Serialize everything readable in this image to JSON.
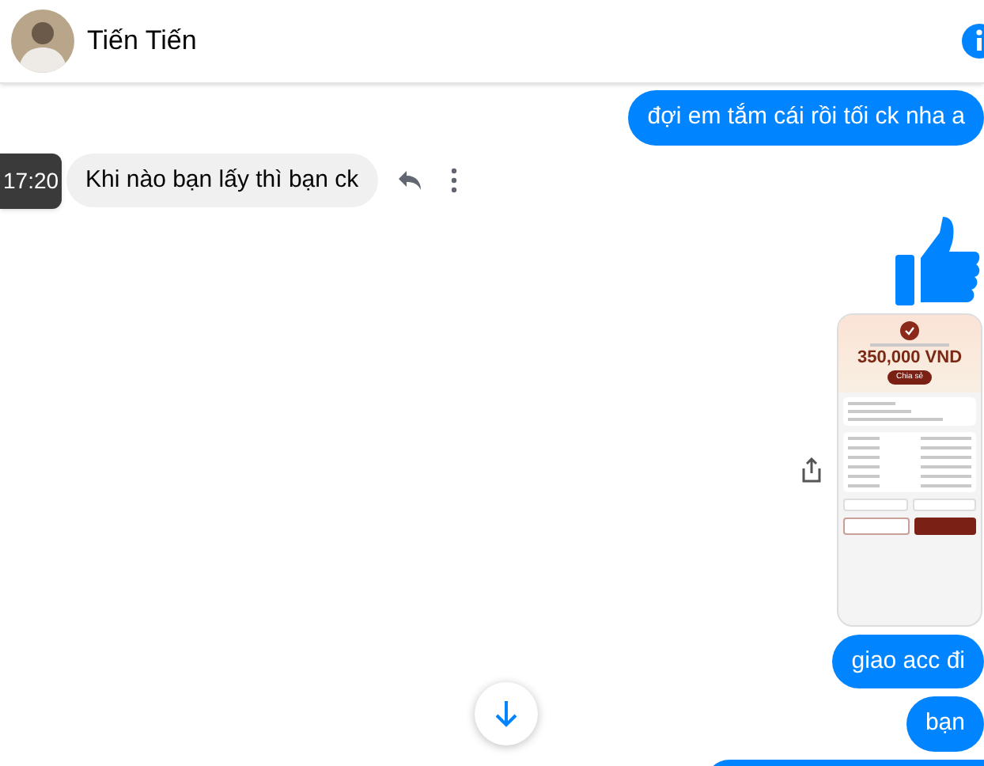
{
  "header": {
    "name": "Tiến Tiến"
  },
  "messages": [
    {
      "kind": "text",
      "outgoing": true,
      "text": "đợi em tắm cái rồi tối ck nha a"
    },
    {
      "kind": "text",
      "outgoing": false,
      "text": "Khi nào bạn lấy thì bạn ck",
      "time": "17:20"
    },
    {
      "kind": "like",
      "outgoing": true
    },
    {
      "kind": "image",
      "outgoing": true,
      "amount": "350,000 VND",
      "share_label": "Chia sẻ"
    },
    {
      "kind": "text",
      "outgoing": true,
      "text": "giao acc đi"
    },
    {
      "kind": "text",
      "outgoing": true,
      "text": "bạn"
    },
    {
      "kind": "partial",
      "outgoing": true
    }
  ]
}
